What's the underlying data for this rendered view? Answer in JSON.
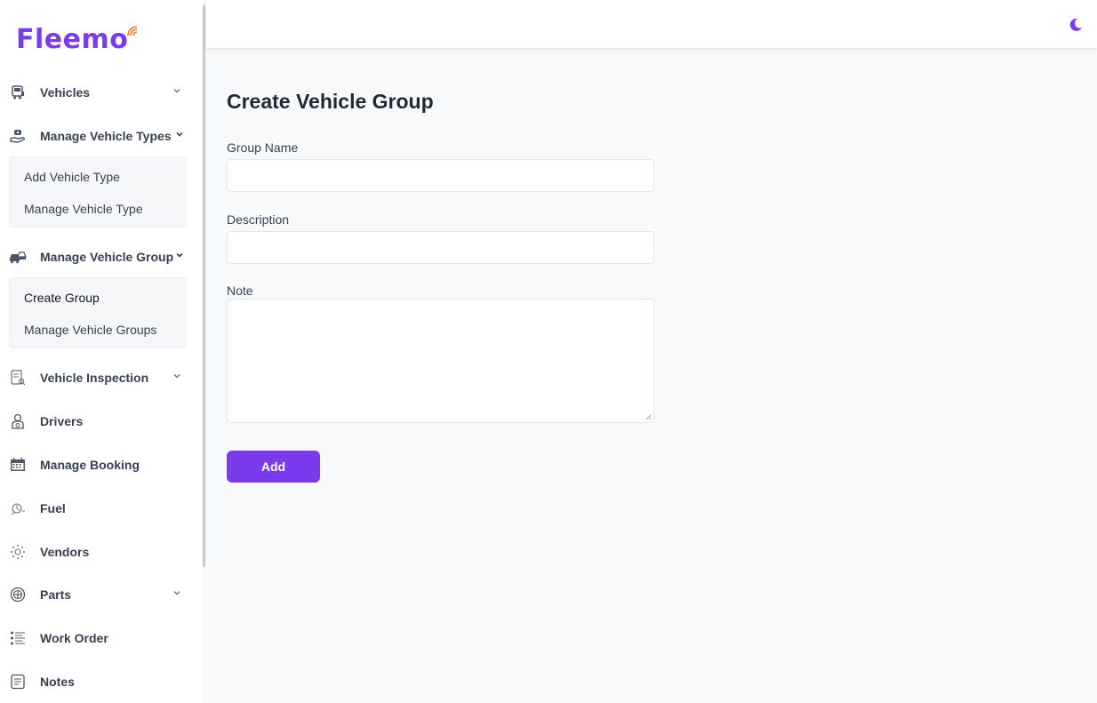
{
  "app": {
    "logo_text": "Fleemo"
  },
  "sidebar": {
    "items": [
      {
        "label": "Vehicles",
        "icon": "truck-icon",
        "has_chevron": true
      },
      {
        "label": "Manage Vehicle Types",
        "icon": "hand-car-icon",
        "has_chevron": true
      },
      {
        "label": "Manage Vehicle Group",
        "icon": "car-group-icon",
        "has_chevron": true
      },
      {
        "label": "Vehicle Inspection",
        "icon": "inspection-icon",
        "has_chevron": true
      },
      {
        "label": "Drivers",
        "icon": "driver-icon",
        "has_chevron": false
      },
      {
        "label": "Manage Booking",
        "icon": "calendar-icon",
        "has_chevron": false
      },
      {
        "label": "Fuel",
        "icon": "fuel-icon",
        "has_chevron": false
      },
      {
        "label": "Vendors",
        "icon": "vendors-icon",
        "has_chevron": false
      },
      {
        "label": "Parts",
        "icon": "wheel-icon",
        "has_chevron": true
      },
      {
        "label": "Work Order",
        "icon": "list-icon",
        "has_chevron": false
      },
      {
        "label": "Notes",
        "icon": "notes-icon",
        "has_chevron": false
      }
    ],
    "vehicle_types_sub": [
      "Add Vehicle Type",
      "Manage Vehicle Type"
    ],
    "vehicle_group_sub": [
      "Create Group",
      "Manage Vehicle Groups"
    ],
    "active_sub": "Create Group"
  },
  "topbar": {
    "theme_icon": "moon-icon"
  },
  "form": {
    "title": "Create Vehicle Group",
    "group_name_label": "Group Name",
    "group_name_value": "",
    "description_label": "Description",
    "description_value": "",
    "note_label": "Note",
    "note_value": "",
    "submit_label": "Add"
  },
  "colors": {
    "accent": "#7c3aed",
    "background": "#f8f9fb",
    "sidebar": "#ffffff"
  }
}
